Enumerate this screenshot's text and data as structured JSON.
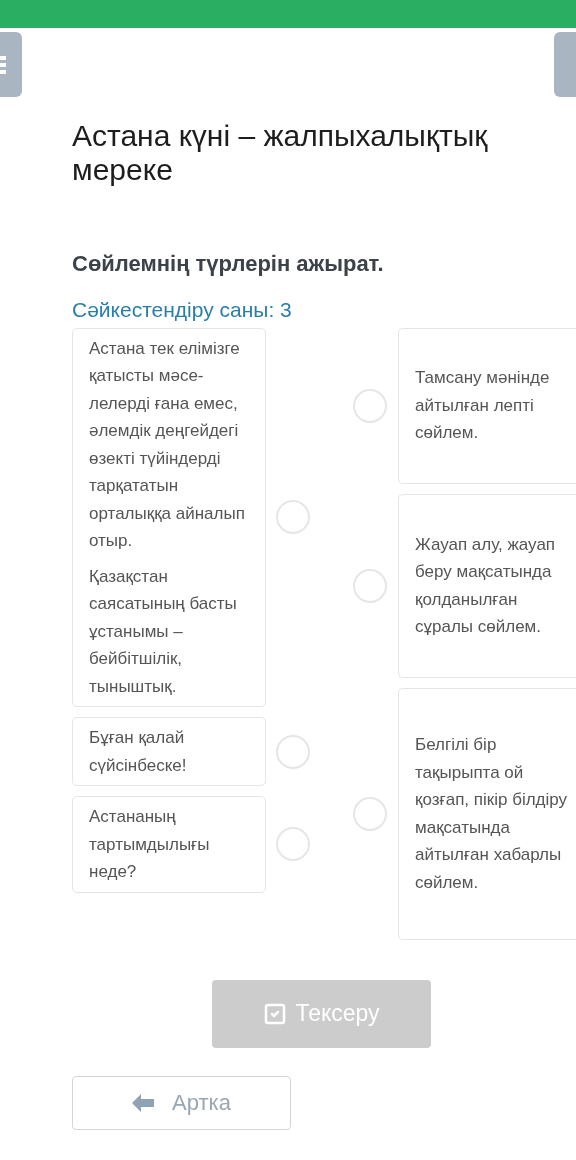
{
  "title": "Астана күні – жалпыхалықтық мереке",
  "instruction": "Сөйлемнің түрлерін ажырат.",
  "match_count": "Сәйкестендіру саны: 3",
  "left_items": [
    {
      "paragraphs": [
        "Астана тек елімізге қатысты мәсе-лелерді ғана емес, әлемдік деңгейдегі өзекті түйіндерді тарқататын орталыққа айналып отыр.",
        "Қазақстан саясатының басты ұстанымы – бейбітшілік, тыныштық."
      ],
      "selected": false
    },
    {
      "paragraphs": [
        "Бұған қалай сүйсінбеске!"
      ],
      "selected": false
    },
    {
      "paragraphs": [
        "Астананың тартымдылығы неде?"
      ],
      "selected": false
    }
  ],
  "right_items": [
    {
      "text": "Тамсану мәнінде айтылған лепті сөйлем.",
      "selected": false
    },
    {
      "text": "Жауап алу, жауап беру мақсатында қолданылған сұралы сөйлем.",
      "selected": false
    },
    {
      "text": "Белгілі бір тақырыпта ой қозғап, пікір білдіру мақсатында айтылған хабарлы сөйлем.",
      "selected": false
    }
  ],
  "check_button": {
    "label": "Тексеру",
    "disabled": true
  },
  "back_button": {
    "label": "Артка"
  }
}
